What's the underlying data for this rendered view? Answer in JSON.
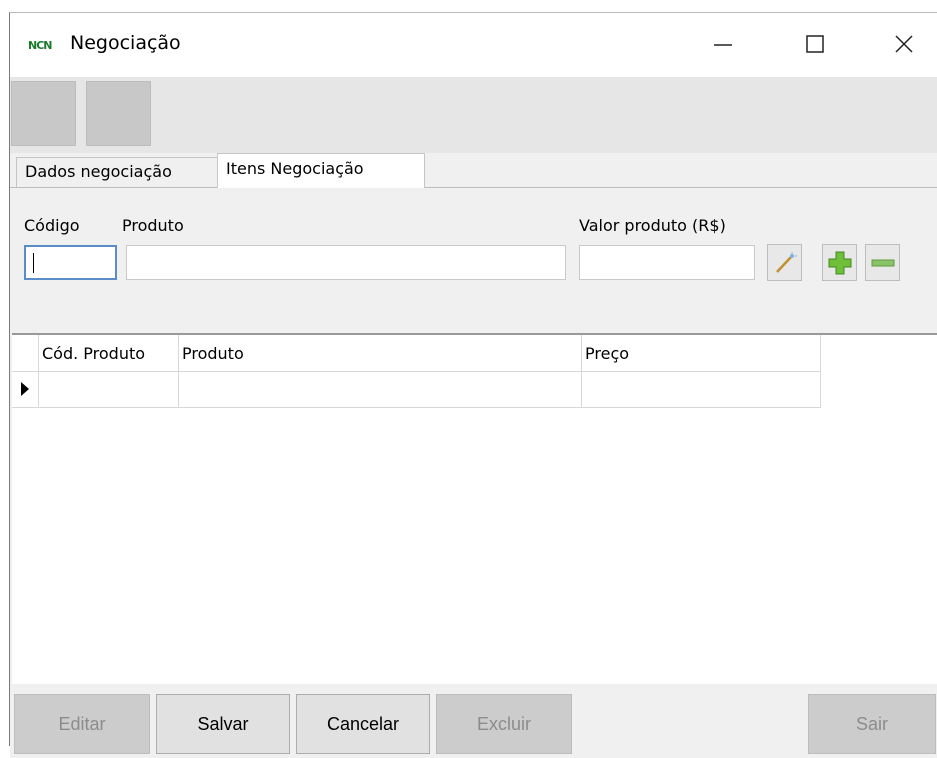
{
  "window": {
    "title": "Negociação",
    "icon": "app-logo-icon",
    "controls": [
      "minimize-icon",
      "maximize-icon",
      "close-icon"
    ]
  },
  "tabs": [
    "Dados negociação",
    "Itens Negociação"
  ],
  "active_tab": "Itens Negociação",
  "form": {
    "codigo_label": "Código",
    "codigo_value": "",
    "produto_label": "Produto",
    "produto_value": "",
    "valor_label": "Valor produto (R$)",
    "valor_value": ""
  },
  "grid": {
    "columns": [
      "Cód. Produto",
      "Produto",
      "Preço"
    ],
    "rows": [
      [
        "",
        "",
        ""
      ]
    ]
  },
  "buttons": {
    "editar": "Editar",
    "salvar": "Salvar",
    "cancelar": "Cancelar",
    "excluir": "Excluir",
    "sair": "Sair"
  },
  "colors": {
    "add": "#6fbf3a",
    "remove": "#8ac46a",
    "focus": "#5a8dc8"
  }
}
